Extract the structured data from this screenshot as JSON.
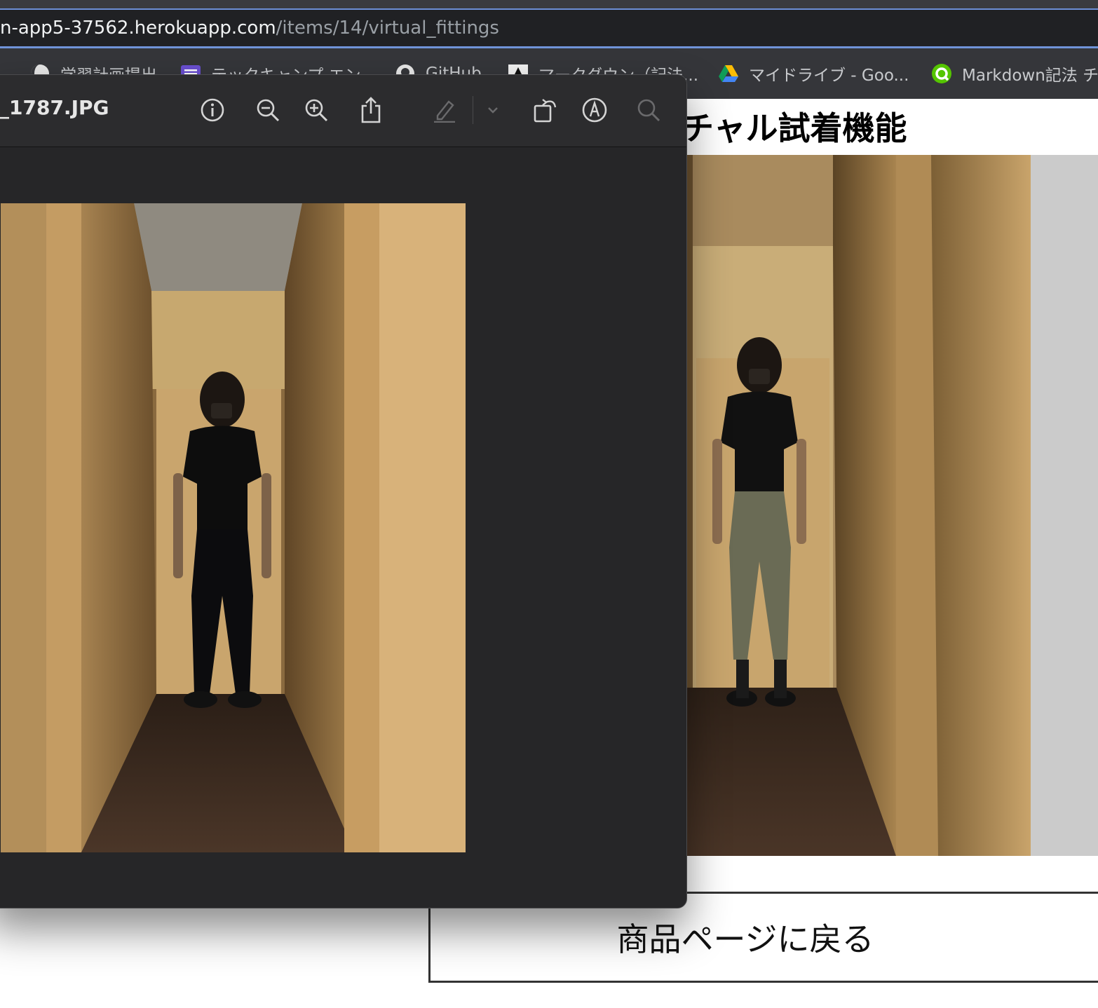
{
  "browser": {
    "url_host": "n-app5-37562.herokuapp.com",
    "url_path": "/items/14/virtual_fittings",
    "bookmarks": [
      {
        "label": "学習計画提出",
        "icon": "moon-circle-icon"
      },
      {
        "label": "テックキャンプ エン...",
        "icon": "list-icon"
      },
      {
        "label": "GitHub",
        "icon": "github-icon"
      },
      {
        "label": "マークダウン（記法...",
        "icon": "markdown-icon"
      },
      {
        "label": "マイドライブ - Goo...",
        "icon": "google-drive-icon"
      },
      {
        "label": "Markdown記法 チ",
        "icon": "qiita-icon"
      }
    ]
  },
  "page": {
    "title": "チャル試着機能",
    "back_button": "商品ページに戻る"
  },
  "preview": {
    "filename": "_1787.JPG",
    "toolbar": [
      "info-icon",
      "zoom-out-icon",
      "zoom-in-icon",
      "share-icon",
      "highlight-pen-icon",
      "chevron-down-icon",
      "rotate-icon",
      "markup-icon",
      "search-icon"
    ]
  },
  "colors": {
    "toolbar_bg": "#2c2c2e",
    "window_bg": "#262628",
    "address_bg": "#202124",
    "focus_ring": "#6f93d8",
    "grey_panel": "#cbcbcb"
  }
}
